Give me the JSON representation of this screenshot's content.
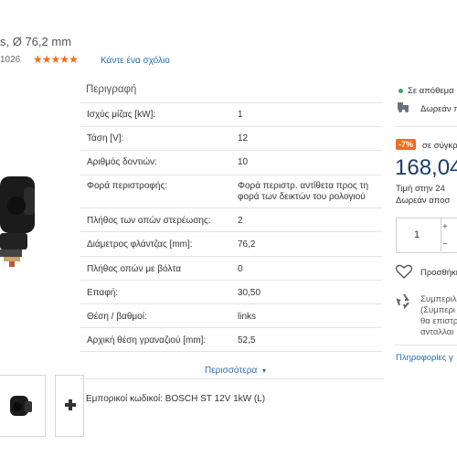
{
  "product": {
    "title": "s, Ø 76,2 mm",
    "code_fragment": "1026",
    "rating_stars": 5,
    "review_link": "Κάντε ένα σχόλιο"
  },
  "description": {
    "heading": "Περιγραφή",
    "rows": [
      {
        "label": "Ισχύς μίζας [kW]:",
        "value": "1"
      },
      {
        "label": "Τάση [V]:",
        "value": "12"
      },
      {
        "label": "Αριθμός δοντιών:",
        "value": "10"
      },
      {
        "label": "Φορά περιστροφής:",
        "value_line1": "Φορά περιστρ. αντίθετα προς τη",
        "value_line2": "φορά των δεικτών του ρολογιού"
      },
      {
        "label": "Πλήθος των οπών στερέωσης:",
        "value": "2"
      },
      {
        "label": "Διάμετρος φλάντζας [mm]:",
        "value": "76,2"
      },
      {
        "label": "Πλήθος οπών με βόλτα",
        "value": "0"
      },
      {
        "label": "Επαφή:",
        "value": "30,50"
      },
      {
        "label": "Θέση / βαθμοί:",
        "value": "links"
      },
      {
        "label": "Αρχική θέση γραναζιού [mm]:",
        "value": "52,5"
      }
    ],
    "more_label": "Περισσότερα",
    "more_chevron": "▾",
    "trade_codes": "Εμπορικοί κωδικοί: BOSCH ST 12V 1kW (L)"
  },
  "sidebar": {
    "stock": "Σε απόθεμα",
    "delivery": "Δωρεάν π",
    "discount": "-7%",
    "compare": "σε σύγκρ",
    "price": "168,04",
    "unit_price": "Τιμή στην 24",
    "free_shipping": "Δωρεάν αποσ",
    "quantity": "1",
    "qty_plus": "+",
    "qty_minus": "−",
    "wishlist": "Προσθήκη",
    "recycle_line1": "Συμπεριλ",
    "recycle_line2": "(Συμπερι",
    "recycle_line3": "θα επιστρ",
    "recycle_line4": "ανταλλαι",
    "info_link": "Πληροφορίες γ"
  },
  "colors": {
    "accent": "#f26c1b",
    "price": "#1c3d6d",
    "link": "#1a6fb0",
    "in_stock": "#2eaa6b"
  },
  "icons": {
    "stars": "star-icon",
    "delivery": "truck-icon",
    "heart": "heart-icon",
    "recycle": "recycle-icon",
    "chevron": "chevron-down-icon"
  }
}
